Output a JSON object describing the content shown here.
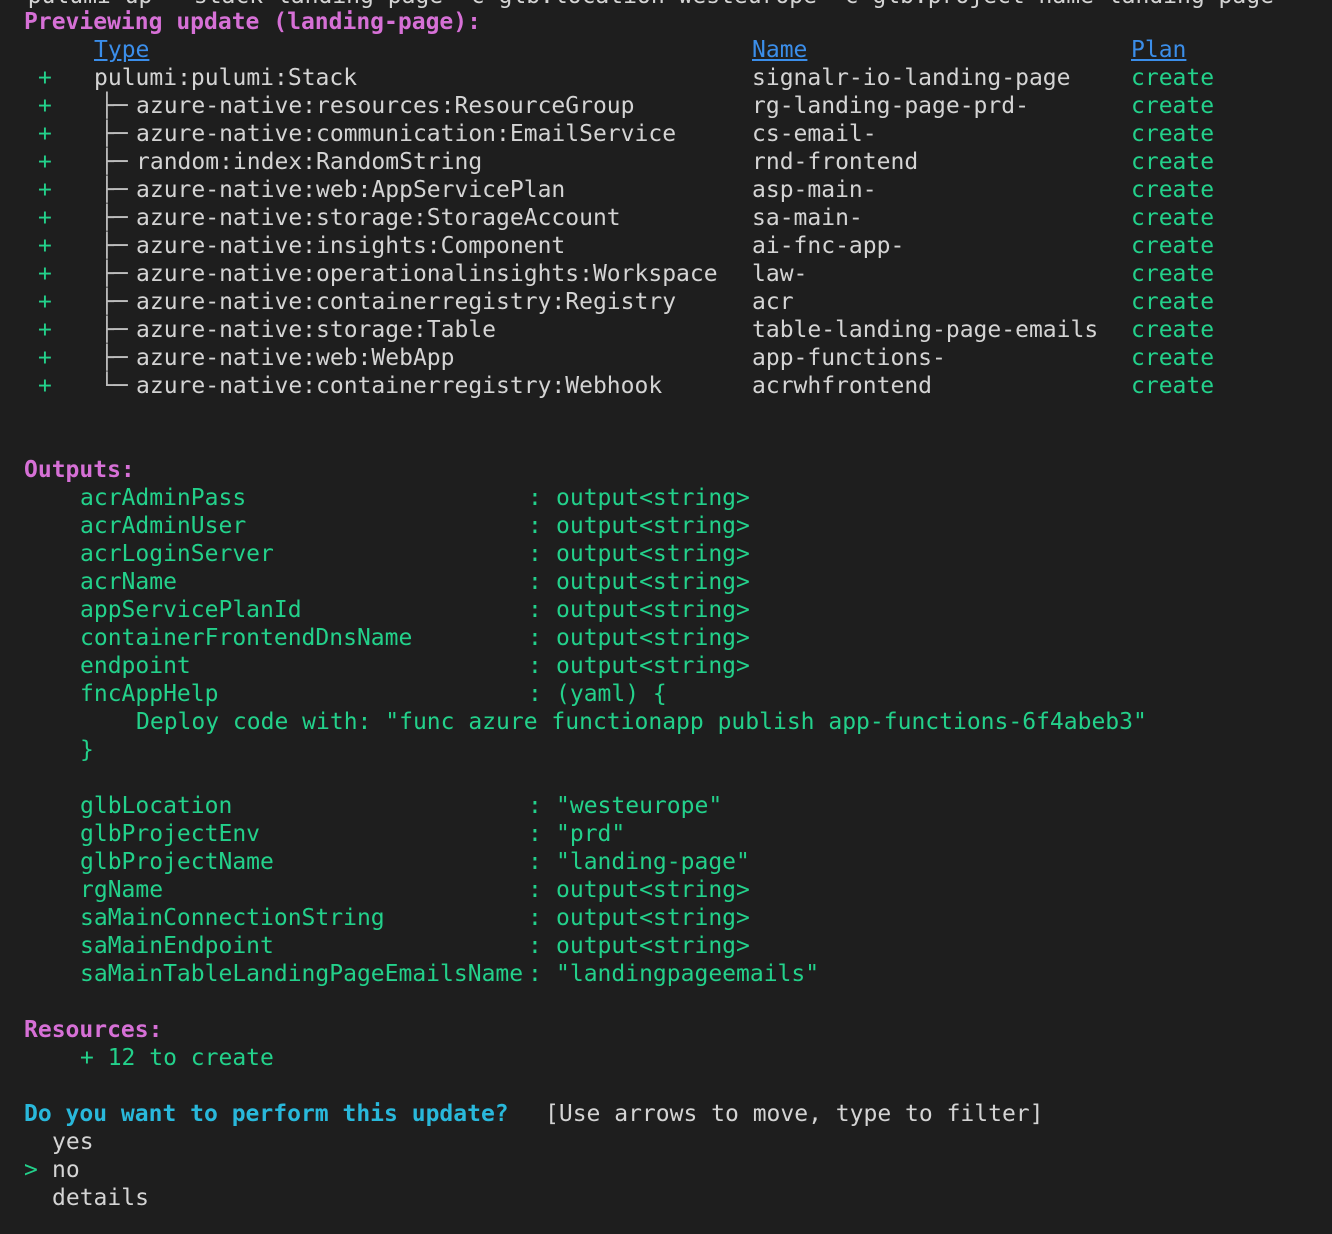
{
  "command_line_cut": "  pulumi up --stack landing-page -c glb:location=westeurope -c glb:project-name=landing-page",
  "preview_heading": "Previewing update (landing-page):",
  "table": {
    "headers": {
      "type": "Type",
      "name": "Name",
      "plan": "Plan"
    },
    "rows": [
      {
        "op": "+",
        "tree": "  ",
        "type": "pulumi:pulumi:Stack",
        "name": "signalr-io-landing-page",
        "plan": "create"
      },
      {
        "op": "+",
        "tree": "├─ ",
        "type": "azure-native:resources:ResourceGroup",
        "name": "rg-landing-page-prd-",
        "plan": "create"
      },
      {
        "op": "+",
        "tree": "├─ ",
        "type": "azure-native:communication:EmailService",
        "name": "cs-email-",
        "plan": "create"
      },
      {
        "op": "+",
        "tree": "├─ ",
        "type": "random:index:RandomString",
        "name": "rnd-frontend",
        "plan": "create"
      },
      {
        "op": "+",
        "tree": "├─ ",
        "type": "azure-native:web:AppServicePlan",
        "name": "asp-main-",
        "plan": "create"
      },
      {
        "op": "+",
        "tree": "├─ ",
        "type": "azure-native:storage:StorageAccount",
        "name": "sa-main-",
        "plan": "create"
      },
      {
        "op": "+",
        "tree": "├─ ",
        "type": "azure-native:insights:Component",
        "name": "ai-fnc-app-",
        "plan": "create"
      },
      {
        "op": "+",
        "tree": "├─ ",
        "type": "azure-native:operationalinsights:Workspace",
        "name": "law-",
        "plan": "create"
      },
      {
        "op": "+",
        "tree": "├─ ",
        "type": "azure-native:containerregistry:Registry",
        "name": "acr",
        "plan": "create"
      },
      {
        "op": "+",
        "tree": "├─ ",
        "type": "azure-native:storage:Table",
        "name": "table-landing-page-emails",
        "plan": "create"
      },
      {
        "op": "+",
        "tree": "├─ ",
        "type": "azure-native:web:WebApp",
        "name": "app-functions-",
        "plan": "create"
      },
      {
        "op": "+",
        "tree": "└─ ",
        "type": "azure-native:containerregistry:Webhook",
        "name": "acrwhfrontend",
        "plan": "create"
      }
    ]
  },
  "outputs": {
    "heading": "Outputs:",
    "items": [
      {
        "key": "acrAdminPass",
        "value": "output<string>"
      },
      {
        "key": "acrAdminUser",
        "value": "output<string>"
      },
      {
        "key": "acrLoginServer",
        "value": "output<string>"
      },
      {
        "key": "acrName",
        "value": "output<string>"
      },
      {
        "key": "appServicePlanId",
        "value": "output<string>"
      },
      {
        "key": "containerFrontendDnsName",
        "value": "output<string>"
      },
      {
        "key": "endpoint",
        "value": "output<string>"
      },
      {
        "key": "fncAppHelp",
        "value": "(yaml) {"
      }
    ],
    "yaml_body": "Deploy code with: \"func azure functionapp publish app-functions-6f4abeb3\"",
    "yaml_close": "}",
    "items2": [
      {
        "key": "glbLocation",
        "value": "\"westeurope\""
      },
      {
        "key": "glbProjectEnv",
        "value": "\"prd\""
      },
      {
        "key": "glbProjectName",
        "value": "\"landing-page\""
      },
      {
        "key": "rgName",
        "value": "output<string>"
      },
      {
        "key": "saMainConnectionString",
        "value": "output<string>"
      },
      {
        "key": "saMainEndpoint",
        "value": "output<string>"
      },
      {
        "key": "saMainTableLandingPageEmailsName",
        "value": "\"landingpageemails\""
      }
    ]
  },
  "resources": {
    "heading": "Resources:",
    "summary": "+ 12 to create"
  },
  "prompt": {
    "question": "Do you want to perform this update?",
    "hint": "[Use arrows to move, type to filter]",
    "cursor": ">",
    "options": [
      "yes",
      "no",
      "details"
    ],
    "selected_index": 1
  }
}
